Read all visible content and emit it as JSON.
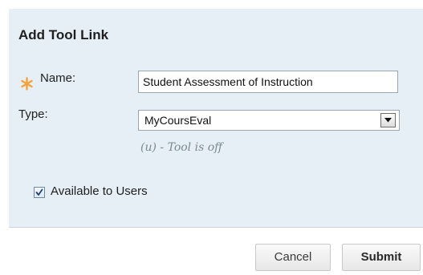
{
  "dialog": {
    "title": "Add Tool Link"
  },
  "form": {
    "name_label": "Name:",
    "name_value": "Student Assessment of Instruction",
    "type_label": "Type:",
    "type_value": "MyCoursEval",
    "type_hint": "(u) - Tool is off",
    "available_label": "Available to Users",
    "available_checked": true
  },
  "actions": {
    "cancel_label": "Cancel",
    "submit_label": "Submit"
  },
  "colors": {
    "panel_bg": "#e5eff5",
    "required_star": "#f2a33a"
  },
  "icons": {
    "required": "asterisk-icon",
    "dropdown": "chevron-down-icon",
    "checkbox": "checkmark-icon"
  }
}
